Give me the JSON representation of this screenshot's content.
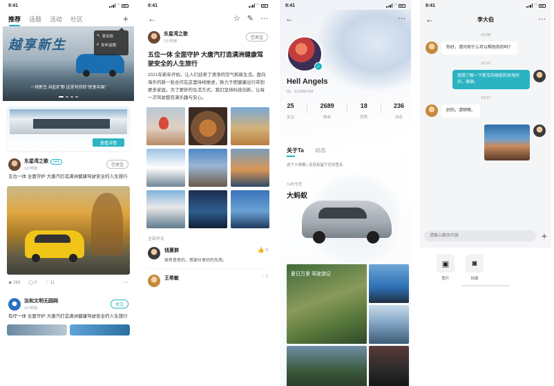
{
  "p1": {
    "time": "9:41",
    "tabs": [
      {
        "label": "推荐"
      },
      {
        "label": "话题"
      },
      {
        "label": "活动"
      },
      {
        "label": "社区"
      }
    ],
    "popup": [
      {
        "label": "发动态"
      },
      {
        "label": "发布话题"
      }
    ],
    "banner": {
      "headline": "越享新生",
      "sub": "一场新生 共赴旷野 这里有你的\"悦享中国\""
    },
    "promo": {
      "button": "查看详情"
    },
    "post1": {
      "author": "东星湾之歌",
      "badge": "new",
      "follow": "已关注",
      "time": "1小时前",
      "text": "五位一体 全面守护 大唐汽打造满洲健康驾驶安全的人生旅行"
    },
    "post1_stats": {
      "views": "263",
      "comments": "0",
      "likes": "11"
    },
    "post2": {
      "author": "汝和文明无园网",
      "follow": "关注",
      "time": "2小时前",
      "text": "有仔一体 全面守护 大唐汽打造满洲健康驾驶安全的人生旅行"
    }
  },
  "p2": {
    "time": "9:41",
    "author": "东星湾之歌",
    "author_time": "1小时前",
    "follow": "已关注",
    "title": "五位一体 全面守护 大唐汽打造满洲健康驾驶安全的人生旅行",
    "body": "2021年新年开始，让人们迎来了清净的空气和新生活。面向海外的新一轮合作在这里持续推进，致力于把健康出行带到更多家庭。为了更好的生活方式，我们坚持科技创新，让每一次驾驶都充满乐趣与安心。",
    "comments_title": "全部评论",
    "comments": [
      {
        "name": "钱夏群",
        "text": "很有意思的，感谢分享好的东西。",
        "likes": "6"
      },
      {
        "name": "王希敏",
        "text": "",
        "likes": "7"
      }
    ]
  },
  "p3": {
    "time": "9:41",
    "name": "Hell Angels",
    "id": "ID：123456789",
    "stats": [
      {
        "value": "25",
        "label": "关注"
      },
      {
        "value": "2689",
        "label": "粉丝"
      },
      {
        "value": "18",
        "label": "获赞"
      },
      {
        "value": "236",
        "label": "动态"
      }
    ],
    "tabs": [
      {
        "label": "关于Ta"
      },
      {
        "label": "动态"
      }
    ],
    "intro": "这个人很懒  |  还没有留下任何签名",
    "car_label": "Ta的车型",
    "car_name": "大蚂蚁",
    "photo_caption": "夏日万里 驾驶游记"
  },
  "p4": {
    "time": "9:41",
    "title": "李大伯",
    "timestamps": [
      "10:08",
      "10:10",
      "10:12"
    ],
    "messages": [
      {
        "side": "them",
        "text": "你好，请问有什么可以帮助你的吗？"
      },
      {
        "side": "me",
        "text": "我想了解一下新车的续航和充电时间，谢谢。"
      },
      {
        "side": "them",
        "text": "好的，请稍等。"
      }
    ],
    "input_placeholder": "请输入聊天内容",
    "tray": [
      {
        "label": "图片"
      },
      {
        "label": "拍摄"
      }
    ]
  }
}
